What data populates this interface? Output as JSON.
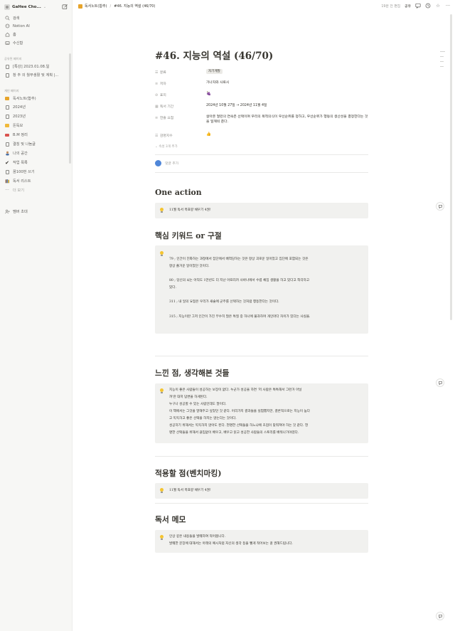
{
  "sidebar": {
    "workspace_name": "GaHee Cho...",
    "top_items": [
      {
        "icon": "search-icon",
        "label": "검색"
      },
      {
        "icon": "notion-ai-icon",
        "label": "Notion AI"
      },
      {
        "icon": "home-icon",
        "label": "홈"
      },
      {
        "icon": "inbox-icon",
        "label": "수신함"
      }
    ],
    "shared_title": "공유된 페이지",
    "shared_items": [
      {
        "label": "[특강] 2023.01.08.일"
      },
      {
        "label": "창 추 의 월부생활 및 계획 |..."
      }
    ],
    "private_title": "개인 페이지",
    "private_items": [
      {
        "label": "독서노트(합추)"
      },
      {
        "label": "2024년"
      },
      {
        "label": "2023년"
      },
      {
        "label": "돈독모"
      },
      {
        "label": "B.M 정리"
      },
      {
        "label": "결칭 및 나눔글"
      },
      {
        "label": "나의 공간"
      },
      {
        "label": "작업 목록"
      },
      {
        "label": "꿈100번 쓰기"
      },
      {
        "label": "독서 리스트"
      },
      {
        "label": "더 보기"
      }
    ],
    "invite_label": "멤버 초대"
  },
  "topbar": {
    "breadcrumb_parent": "독서노트(합추)",
    "breadcrumb_separator": "/",
    "breadcrumb_current": "#46. 지능의 역설 (46/70)",
    "edited": "19분 전 편집",
    "share": "공유"
  },
  "page": {
    "title": "#46. 지능의 역설 (46/70)",
    "properties": [
      {
        "key": "분류",
        "icon": "list-icon",
        "value": "자기계발",
        "type": "tag"
      },
      {
        "key": "저자",
        "icon": "text-icon",
        "value": "가나자와 사토시",
        "type": "text"
      },
      {
        "key": "표지",
        "icon": "paperclip-icon",
        "value": "🍇",
        "type": "emoji"
      },
      {
        "key": "독서 기간",
        "icon": "calendar-icon",
        "value": "2024년 10월 27일 → 2024년 11월 4일",
        "type": "text"
      },
      {
        "key": "한줄 요점",
        "icon": "text-icon",
        "value": "살아온 얼련의 연속은 선택이며 우리의 목적의식이 우선순위를 정하고, 우선순위가 행동의 생산성을 결정한다는 것을 일깨워 준다.",
        "type": "text"
      },
      {
        "key": "감명지수",
        "icon": "list-icon",
        "value": "👍",
        "type": "emoji"
      }
    ],
    "add_props": "속성 3개 추가",
    "comment_placeholder": "댓글 추가"
  },
  "sections": {
    "one_action": {
      "heading": "One action",
      "callout": "11월 독서 목표량 채우기 4권!"
    },
    "keywords": {
      "heading": "핵심 키워드 or 구절",
      "lines": [
        "79 ; 인간이 진화하는 과정에서 집단에서 배척당하는 것은 항상 괴로운 일이었고 집단에 포함되는 것은",
        "항상 즐거운 일이었던 것이다.",
        "80 ; 당신의 뇌는 아직도 1만년도 더 지난 아프리카 사바나에서 수렵 채집 생활을 하고 있다고 착각하고",
        "있다.",
        "311 ; 내 일의 요점은 우리가 새술에 군주를 선택하는 것처럼 행동한다는 것이다.",
        "315 ; 지능이란 그저 인간이 가진 무수히 많은 특질 중 하나에 불과하며 개인마다 차이가 있다는 사실을."
      ]
    },
    "reflection": {
      "heading": "느낀 점, 생각해본 것들",
      "lines": [
        "지능이 좋은 사람들이 성공하는 보장이 없다. 누군가 성공을 하면 '저 사람은 특특해서 그런거 아닐",
        "까'란 대저 답변을 하게된다.",
        "누구나 성공할 수 있는 사람인데도 말이다.",
        "이 책에서는 그것을 말해주고 싶었던 것 같다. 어리가지 결과들을 실험했지만, 결론적으로는 지능이 높다",
        "고 똑똑하고 좋은 선택을 하지는 않는다는 것이다.",
        "성공하기 위해서는 똑똑하지 않아도 된다. 현명한 선택들을 하느냐에 초점이 맞춰져야 하는 것 같다. 현",
        "명한 선택들을 위해서 끊임없이 배우고, 배우고 읽고 성공한 사람들의 스토리를 배워나가야겠다."
      ]
    },
    "apply": {
      "heading": "적용할 점(벤치마킹)",
      "callout": "11월 독서 목표량 채우기 4권!"
    },
    "memo": {
      "heading": "독서 메모",
      "lines": [
        "인상 깊은 내용들을 발췌하여 적어봅니다.",
        "발췌한 문장에 대해서는 아래의 예시처럼 자신의 생각 등을 뻘게 적어보는 걸 권해드립니다."
      ]
    }
  },
  "colors": {
    "sidebar_bg": "#f7f7f5",
    "callout_bg": "#f1f1ef",
    "text": "#37352f",
    "muted": "#8a8985"
  }
}
